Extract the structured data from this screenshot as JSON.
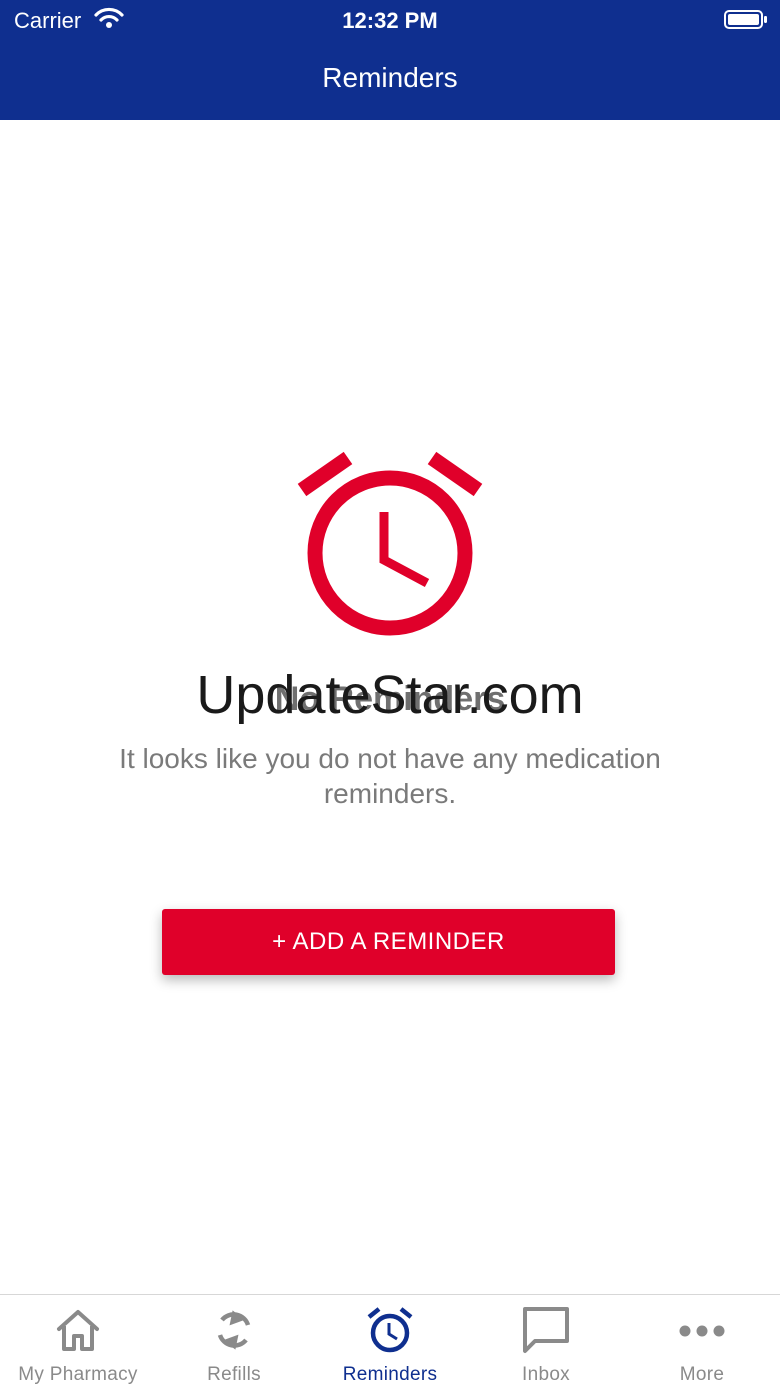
{
  "status_bar": {
    "carrier": "Carrier",
    "time": "12:32 PM"
  },
  "nav": {
    "title": "Reminders"
  },
  "empty_state": {
    "icon": "alarm-clock-icon",
    "title": "No Reminders",
    "description": "It looks like you do not have any medication reminders.",
    "watermark": "UpdateStar.com"
  },
  "add_button": {
    "label": "+ ADD A REMINDER"
  },
  "tabs": [
    {
      "label": "My Pharmacy",
      "icon": "home-icon"
    },
    {
      "label": "Refills",
      "icon": "refresh-icon"
    },
    {
      "label": "Reminders",
      "icon": "alarm-clock-icon",
      "active": true
    },
    {
      "label": "Inbox",
      "icon": "chat-bubble-icon"
    },
    {
      "label": "More",
      "icon": "more-dots-icon"
    }
  ],
  "colors": {
    "brand_blue": "#0f2f8f",
    "accent_red": "#e0002a",
    "muted_gray": "#8a8a8a"
  }
}
